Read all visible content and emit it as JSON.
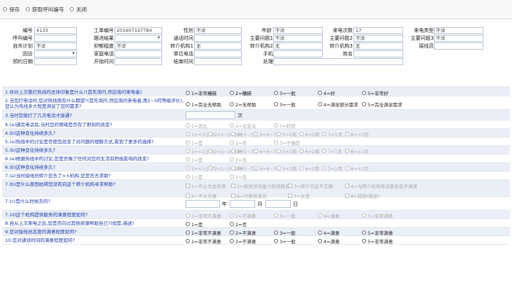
{
  "toolbar": {
    "save": "保存",
    "get_call_id": "获取呼叫编号",
    "close": "关闭"
  },
  "fields": {
    "biao_hao": {
      "label": "编号",
      "value": "4133"
    },
    "gongdan": {
      "label": "工单编号",
      "value": "201607197784"
    },
    "xingbie": {
      "label": "性别",
      "value": "不详"
    },
    "nianling": {
      "label": "年龄",
      "value": "不详"
    },
    "laidian_cishu": {
      "label": "来电次数",
      "value": "17"
    },
    "laidian_leixing": {
      "label": "来电类型",
      "value": "不详"
    },
    "hujiao": {
      "label": "呼叫编号",
      "value": ""
    },
    "zhuanji": {
      "label": "跟进结果",
      "value": ""
    },
    "tonghua": {
      "label": "通话时间",
      "value": ""
    },
    "zhuyao_wenti1": {
      "label": "主要问题1",
      "value": "不详"
    },
    "zhuyao_wenti2": {
      "label": "主要问题2",
      "value": "不详"
    },
    "zhuyao_wenti3": {
      "label": "主要问题3",
      "value": "不详"
    },
    "zisha": {
      "label": "自杀计划",
      "value": "不详"
    },
    "yiyuzheng": {
      "label": "抑郁程度",
      "value": "不详"
    },
    "zhuanjie1": {
      "label": "转介机构1",
      "value": "无"
    },
    "zhuanjie2": {
      "label": "转介机构2",
      "value": "无"
    },
    "zhuanjie3": {
      "label": "转介机构3",
      "value": "无"
    },
    "jiexianyuan": {
      "label": "接线员",
      "value": ""
    },
    "huifang": {
      "label": "回访",
      "value": ""
    },
    "jiating": {
      "label": "家庭电话",
      "value": ""
    },
    "danwei": {
      "label": "单位电话",
      "value": ""
    },
    "shouji": {
      "label": "手机",
      "value": ""
    },
    "xingming": {
      "label": "姓名",
      "value": ""
    },
    "yuyue": {
      "label": "预约日期",
      "value": ""
    },
    "kaishi": {
      "label": "开始时间",
      "value": ""
    },
    "jieshu": {
      "label": "结束时间",
      "value": ""
    },
    "chuli": {
      "label": "处理",
      "value": ""
    }
  },
  "questions": [
    {
      "text": "1.你对上次我打热线的总体印象是什么?(首先询问,然后询问来电者)",
      "opts": [
        "1=非常糟糕",
        "2=糟糕",
        "3=一般",
        "4=好",
        "5=非常好"
      ],
      "type": "radio",
      "dis": false
    },
    {
      "text": "2.当您打电话时,您对热线抱有什么期望?(首先询问,然后询问来电者,用1~5的等级评价),您认为热线多大程度满足了您的需求?",
      "opts": [
        "1=完全无帮助",
        "2=无帮助",
        "3=一般",
        "4=满足部分需求",
        "5=完全满足需求"
      ],
      "type": "radio",
      "dis": false
    },
    {
      "text": "3.当时您拨打了几次电话才接通?",
      "type": "num",
      "unit": "次",
      "dis": false
    },
    {
      "text": "4.(a)通完电话后,当时您的情绪是否有了即刻的改变?",
      "opts": [
        "1=恶化",
        "2=无变化",
        "3=好转"
      ],
      "type": "radio",
      "dis": true
    },
    {
      "text": "4.(b)这种变化持续多久?",
      "opts": [
        "1=<1小时",
        "2=1~24小时",
        "3=1~7天",
        "4=4~7天",
        "5=1周",
        "6=2周",
        "7=1月",
        "8=>1月"
      ],
      "type": "radio",
      "dis": true
    },
    {
      "text": "5.(a)热线中的讨论是否使您改变了对问题的理解方式,看到了更多的选择?",
      "opts": [
        "1=是",
        "2=否",
        "3=不确定"
      ],
      "type": "radio",
      "dis": true
    },
    {
      "text": "5.(b)这种变化持续多久?",
      "opts": [
        "1=<1小时",
        "2=1~24小时",
        "3=1~7天",
        "4=4~7天",
        "5=1周",
        "6=2周",
        "7=1月",
        "8=>1月"
      ],
      "type": "radio",
      "dis": true
    },
    {
      "text": "6.(a)根据热线中的讨论,您是否做了任何对您的生活有积极影响的改变?",
      "opts": [
        "1=是",
        "2=否"
      ],
      "type": "radio",
      "dis": true
    },
    {
      "text": "6.(b)这种变化持续多久?",
      "opts": [
        "1=<1小时",
        "2=1~24小时",
        "3=1~7天",
        "4=4~7天",
        "5=1周",
        "6=2周",
        "7=1月",
        "8=>1月"
      ],
      "type": "radio",
      "dis": true
    },
    {
      "text": "7.(a)当时接线员转介您去了××机构,您是否去求助?",
      "opts": [
        "1=是",
        "2=否"
      ],
      "type": "radio",
      "dis": true
    },
    {
      "text": "7.(b)是什么原因妨碍您没有向这个转介机构寻求帮助?",
      "opts": [
        "1=不认为会有用",
        "2=感觉没有能力和该联系",
        "3=转介信息不正确",
        "4=与转介机构电话联系但不满意",
        "5=不太方便",
        "6=打算将来去",
        "7=太贵",
        "8=其他(描述)"
      ],
      "type": "check",
      "dis": true
    },
    {
      "text": "7.(c)是什么时候去的?",
      "type": "date",
      "labels": [
        "年",
        "月",
        "日"
      ],
      "dis": false
    },
    {
      "text": "7.(d)这个机构提供服务的满意程度如何?",
      "opts": [
        "1=非常不满意",
        "2=不满意",
        "3=一般",
        "4=满意",
        "5=非常满意"
      ],
      "type": "radio",
      "dis": true
    },
    {
      "text": "8.自从上次来电之后,您是否向过其他资源帮助自己?(如是,描述)",
      "opts": [
        "1=是",
        "2=否"
      ],
      "type": "radio",
      "dis": false
    },
    {
      "text": "9.您对接线员态度的满意程度如何?",
      "opts": [
        "1=非常不满意",
        "2=不满意",
        "3=一般",
        "4=满意",
        "5=非常满意"
      ],
      "type": "radio",
      "dis": false
    },
    {
      "text": "10.您对通话时间的满意程度如何?",
      "opts": [
        "1=非常不满意",
        "2=不满意",
        "3=一般",
        "4=满意",
        "5=非常满意"
      ],
      "type": "radio",
      "dis": false
    }
  ]
}
